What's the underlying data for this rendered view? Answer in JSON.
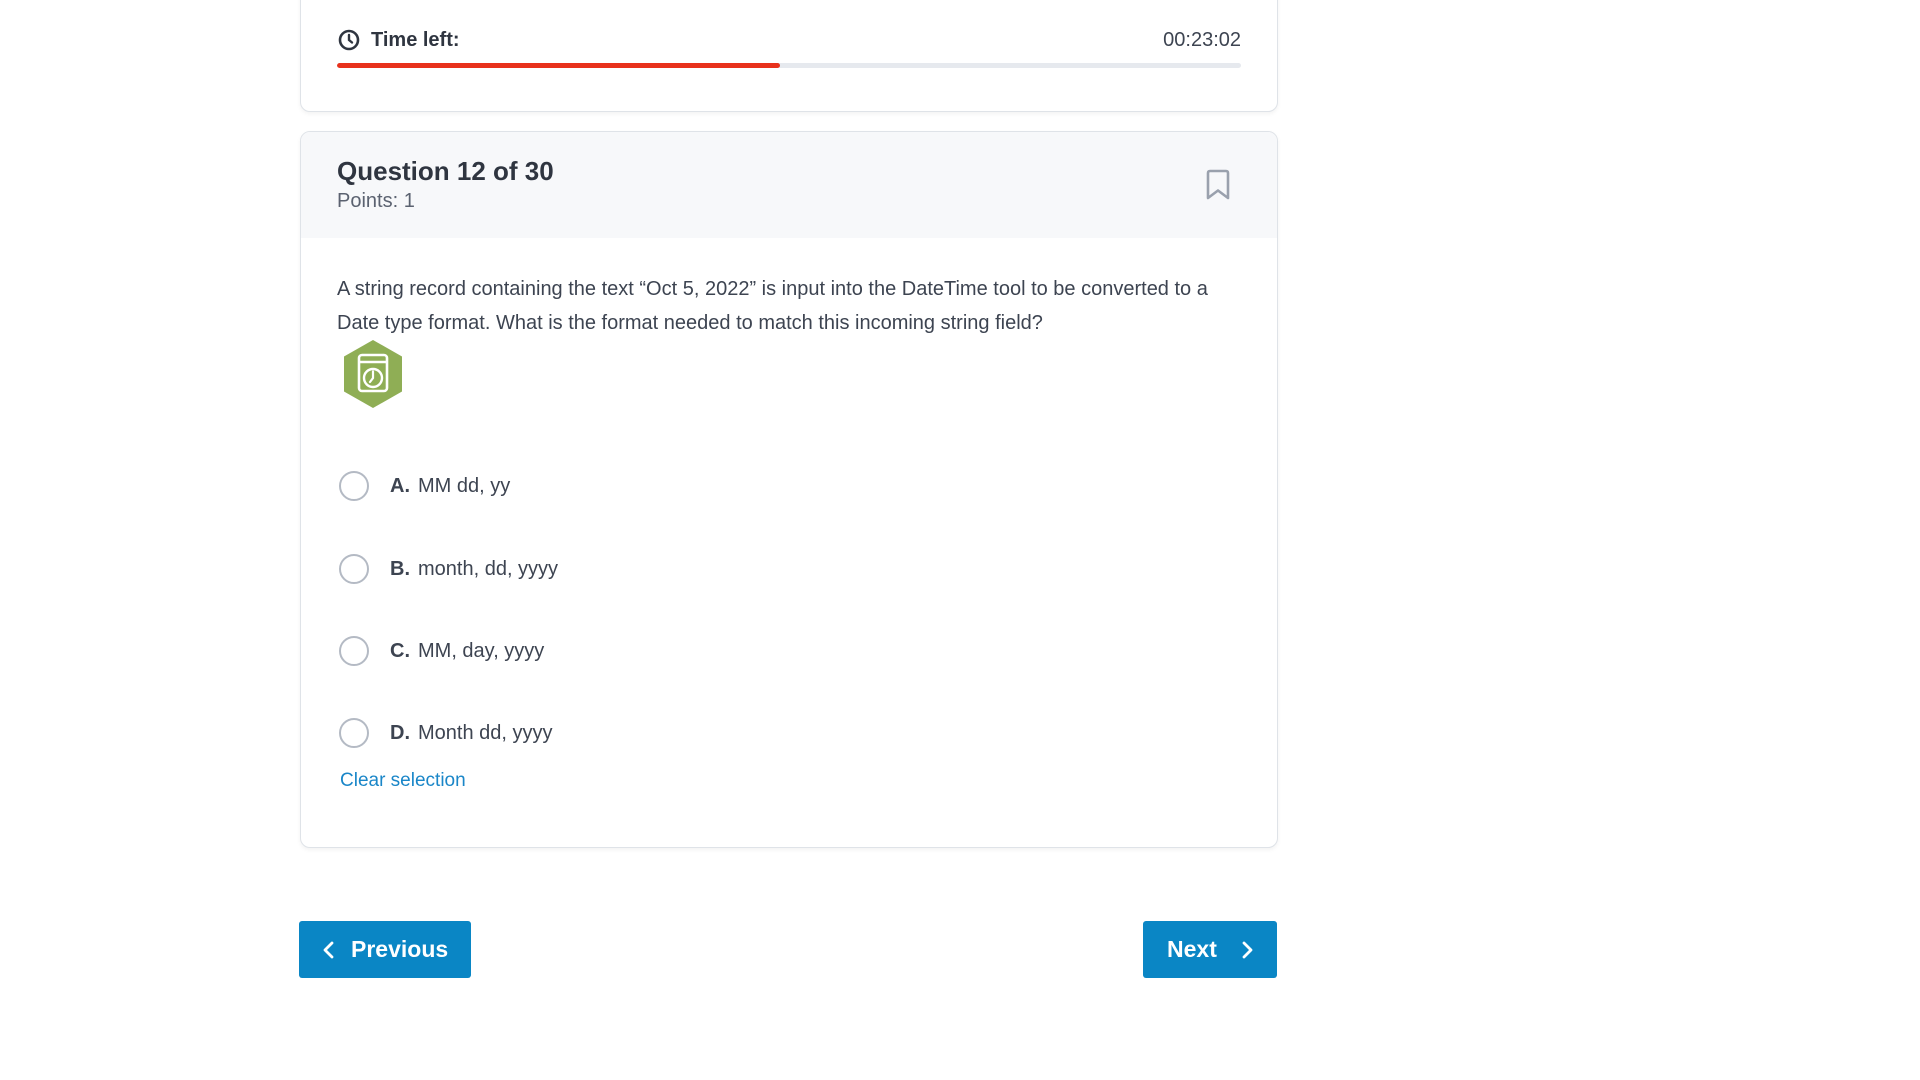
{
  "timer": {
    "label": "Time left:",
    "value": "00:23:02",
    "progress_fraction": 0.49,
    "progress_color": "#e8311c",
    "icon": "clock-icon"
  },
  "question": {
    "title": "Question 12 of 30",
    "points": "Points: 1",
    "text": "A string record containing the text “Oct 5, 2022” is input into the DateTime tool to be converted to a Date type format. What is the format needed to match this incoming string field?",
    "bookmark_icon": "bookmark-icon",
    "tool_icon": "datetime-tool-icon",
    "options": [
      {
        "letter": "A.",
        "text": "MM dd, yy"
      },
      {
        "letter": "B.",
        "text": "month, dd, yyyy"
      },
      {
        "letter": "C.",
        "text": "MM, day, yyyy"
      },
      {
        "letter": "D.",
        "text": "Month dd, yyyy"
      }
    ],
    "clear_label": "Clear selection"
  },
  "nav": {
    "previous_label": "Previous",
    "next_label": "Next",
    "button_color": "#0a86c5"
  }
}
